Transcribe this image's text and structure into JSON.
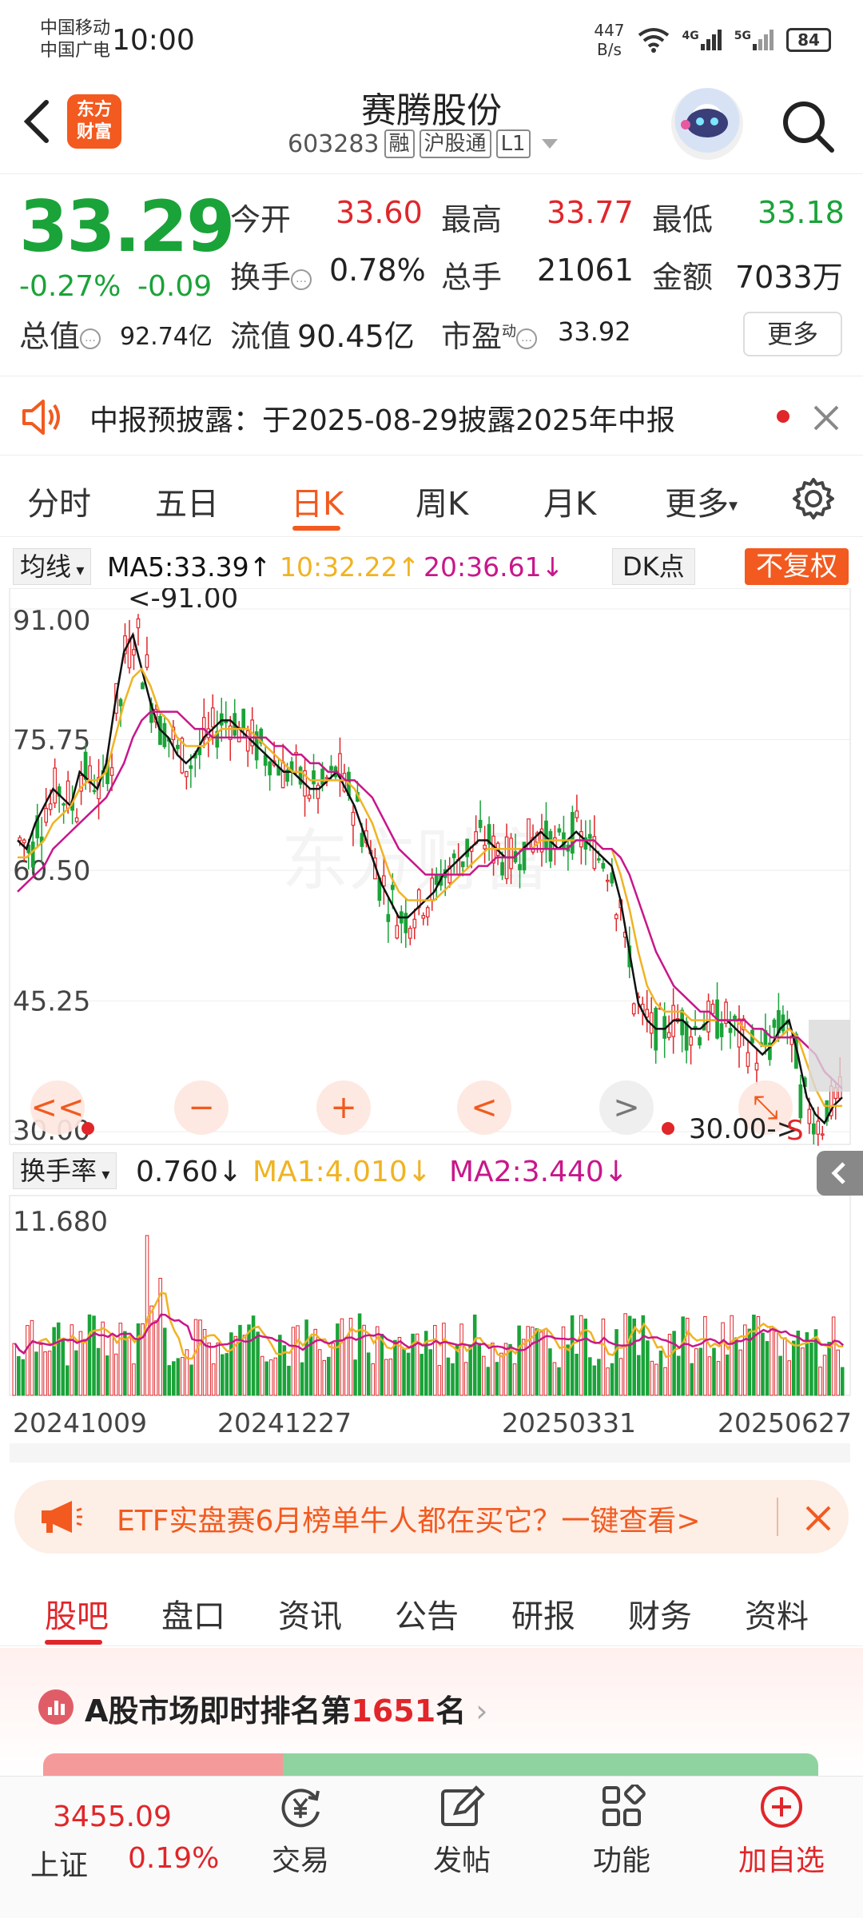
{
  "status_bar": {
    "carrier1": "中国移动",
    "carrier2": "中国广电",
    "time": "10:00",
    "net_speed_value": "447",
    "net_speed_unit": "B/s",
    "signal1": "4G",
    "signal2": "5G",
    "battery": "84"
  },
  "header": {
    "logo_line1": "东方",
    "logo_line2": "财富",
    "stock_name": "赛腾股份",
    "stock_code": "603283",
    "tags": [
      "融",
      "沪股通",
      "L1"
    ]
  },
  "quote": {
    "price": "33.29",
    "change_pct": "-0.27%",
    "change_amt": "-0.09",
    "open_label": "今开",
    "open": "33.60",
    "high_label": "最高",
    "high": "33.77",
    "low_label": "最低",
    "low": "33.18",
    "turnover_label": "换手",
    "turnover": "0.78%",
    "volume_label": "总手",
    "volume": "21061",
    "amount_label": "金额",
    "amount": "7033万",
    "mktcap_label": "总值",
    "mktcap": "92.74亿",
    "float_label": "流值",
    "float_cap": "90.45亿",
    "pe_label": "市盈",
    "pe_sup": "动",
    "pe": "33.92",
    "more_label": "更多"
  },
  "notice": {
    "text": "中报预披露：于2025-08-29披露2025年中报"
  },
  "chart_tabs": {
    "items": [
      "分时",
      "五日",
      "日K",
      "周K",
      "月K",
      "更多"
    ],
    "active": "日K"
  },
  "ma_header": {
    "selector": "均线",
    "ma5": "MA5:33.39↑",
    "ma10": "10:32.22↑",
    "ma20": "20:36.61↓",
    "dk_label": "DK点",
    "adjust_label": "不复权",
    "colors": {
      "ma5": "#111111",
      "ma10": "#f0b323",
      "ma20": "#c8178a"
    }
  },
  "chart_controls": {
    "marker_label": "30.00->",
    "s_marker": "S",
    "max_annot": "<-91.00"
  },
  "turnover_header": {
    "selector": "换手率",
    "value": "0.760↓",
    "ma1": "MA1:4.010↓",
    "ma2": "MA2:3.440↓",
    "y_label": "11.680"
  },
  "chart_data": {
    "type": "candlestick",
    "y_ticks": [
      "91.00",
      "75.75",
      "60.50",
      "45.25",
      "30.00"
    ],
    "ylim": [
      30.0,
      91.0
    ],
    "x_ticks": [
      "20241009",
      "20241227",
      "20250331",
      "20250627"
    ],
    "series": [
      {
        "name": "MA5",
        "color": "#111111",
        "values": [
          64,
          63,
          66,
          68,
          70,
          69,
          68,
          72,
          71,
          70,
          73,
          80,
          86,
          88,
          84,
          80,
          77,
          76,
          74,
          73,
          74,
          76,
          77,
          78,
          78,
          77,
          76,
          75,
          74,
          73,
          72,
          72,
          71,
          70,
          70,
          71,
          72,
          70,
          68,
          65,
          62,
          59,
          57,
          55,
          55,
          56,
          57,
          58,
          60,
          61,
          62,
          63,
          64,
          64,
          63,
          62,
          62,
          63,
          64,
          65,
          64,
          63,
          64,
          65,
          64,
          63,
          62,
          61,
          57,
          51,
          45,
          43,
          42,
          42,
          43,
          43,
          42,
          42,
          43,
          43,
          43,
          42,
          41,
          40,
          39,
          40,
          42,
          43,
          39,
          34,
          32,
          31,
          33,
          34
        ]
      },
      {
        "name": "MA10",
        "color": "#f0b323",
        "values": [
          62,
          62,
          63,
          64,
          66,
          67,
          68,
          70,
          71,
          71,
          72,
          76,
          80,
          83,
          84,
          82,
          79,
          78,
          76,
          75,
          75,
          75,
          76,
          77,
          77,
          77,
          77,
          76,
          75,
          74,
          73,
          72,
          72,
          71,
          71,
          71,
          71,
          71,
          70,
          68,
          66,
          63,
          60,
          58,
          57,
          57,
          57,
          57,
          58,
          59,
          60,
          61,
          62,
          63,
          63,
          63,
          63,
          63,
          63,
          64,
          64,
          64,
          64,
          64,
          64,
          64,
          63,
          63,
          60,
          56,
          51,
          47,
          45,
          44,
          44,
          44,
          43,
          43,
          43,
          43,
          43,
          43,
          42,
          41,
          40,
          40,
          41,
          42,
          41,
          38,
          35,
          33,
          33,
          33
        ]
      },
      {
        "name": "MA20",
        "color": "#c8178a",
        "values": [
          58,
          59,
          60,
          61,
          63,
          64,
          65,
          66,
          67,
          68,
          69,
          71,
          73,
          76,
          78,
          79,
          79,
          79,
          79,
          78,
          77,
          77,
          76,
          76,
          76,
          76,
          76,
          76,
          76,
          75,
          75,
          74,
          74,
          73,
          73,
          72,
          72,
          71,
          71,
          70,
          69,
          67,
          65,
          63,
          62,
          61,
          60,
          60,
          60,
          60,
          60,
          60,
          61,
          61,
          62,
          62,
          62,
          63,
          63,
          63,
          63,
          63,
          63,
          64,
          64,
          64,
          63,
          63,
          62,
          60,
          57,
          54,
          51,
          49,
          47,
          46,
          45,
          44,
          44,
          43,
          43,
          43,
          43,
          42,
          42,
          41,
          41,
          41,
          41,
          40,
          39,
          37,
          36,
          35
        ]
      }
    ],
    "turnover_max": 11.68,
    "turnover_ma_colors": {
      "ma1": "#f0b323",
      "ma2": "#c8178a"
    },
    "watermark": "东方财富"
  },
  "banner": {
    "text": "ETF实盘赛6月榜单牛人都在买它？一键查看>"
  },
  "bottom_tabs": {
    "items": [
      "股吧",
      "盘口",
      "资讯",
      "公告",
      "研报",
      "财务",
      "资料"
    ],
    "active": "股吧"
  },
  "rank": {
    "prefix": "A股市场即时排名第",
    "number": "1651",
    "suffix": "名"
  },
  "footer": {
    "index_value": "3455.09",
    "index_name": "上证",
    "index_pct": "0.19%",
    "buttons": [
      "交易",
      "发帖",
      "功能",
      "加自选"
    ]
  }
}
